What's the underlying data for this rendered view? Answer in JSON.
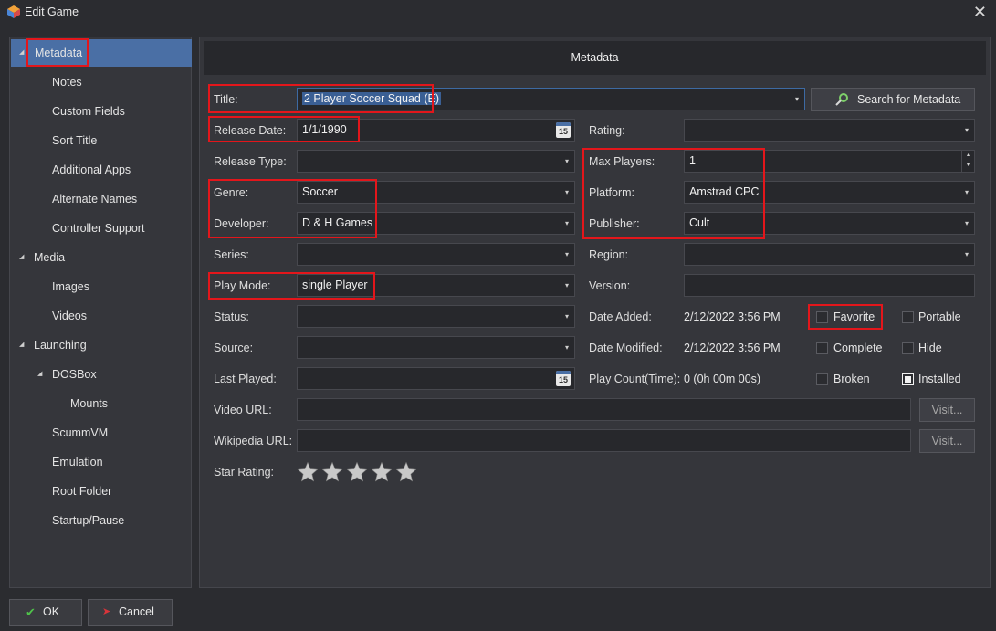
{
  "window": {
    "title": "Edit Game",
    "close_glyph": "✕"
  },
  "sidebar": {
    "items": [
      {
        "label": "Metadata",
        "expander": "◢"
      },
      {
        "label": "Notes"
      },
      {
        "label": "Custom Fields"
      },
      {
        "label": "Sort Title"
      },
      {
        "label": "Additional Apps"
      },
      {
        "label": "Alternate Names"
      },
      {
        "label": "Controller Support"
      },
      {
        "label": "Media",
        "expander": "◢"
      },
      {
        "label": "Images"
      },
      {
        "label": "Videos"
      },
      {
        "label": "Launching",
        "expander": "◢"
      },
      {
        "label": "DOSBox",
        "expander": "◢"
      },
      {
        "label": "Mounts"
      },
      {
        "label": "ScummVM"
      },
      {
        "label": "Emulation"
      },
      {
        "label": "Root Folder"
      },
      {
        "label": "Startup/Pause"
      }
    ]
  },
  "header": {
    "title": "Metadata"
  },
  "fields": {
    "title": {
      "label": "Title:",
      "value": "2 Player Soccer Squad (E)"
    },
    "search_button": "Search for Metadata",
    "release_date": {
      "label": "Release Date:",
      "value": "1/1/1990"
    },
    "rating": {
      "label": "Rating:",
      "value": ""
    },
    "release_type": {
      "label": "Release Type:",
      "value": ""
    },
    "max_players": {
      "label": "Max Players:",
      "value": "1"
    },
    "genre": {
      "label": "Genre:",
      "value": "Soccer"
    },
    "platform": {
      "label": "Platform:",
      "value": "Amstrad CPC"
    },
    "developer": {
      "label": "Developer:",
      "value": "D & H Games"
    },
    "publisher": {
      "label": "Publisher:",
      "value": "Cult"
    },
    "series": {
      "label": "Series:",
      "value": ""
    },
    "region": {
      "label": "Region:",
      "value": ""
    },
    "play_mode": {
      "label": "Play Mode:",
      "value": "single Player"
    },
    "version": {
      "label": "Version:",
      "value": ""
    },
    "status": {
      "label": "Status:",
      "value": ""
    },
    "date_added": {
      "label": "Date Added:",
      "value": "2/12/2022 3:56 PM"
    },
    "source": {
      "label": "Source:",
      "value": ""
    },
    "date_modified": {
      "label": "Date Modified:",
      "value": "2/12/2022 3:56 PM"
    },
    "last_played": {
      "label": "Last Played:",
      "value": ""
    },
    "play_count": {
      "label": "Play Count(Time):",
      "value": "0 (0h 00m 00s)"
    },
    "video_url": {
      "label": "Video URL:",
      "value": ""
    },
    "wikipedia_url": {
      "label": "Wikipedia URL:",
      "value": ""
    },
    "visit_label": "Visit...",
    "star_rating": {
      "label": "Star Rating:",
      "stars": 0,
      "max": 5
    }
  },
  "checkboxes": {
    "favorite": {
      "label": "Favorite",
      "checked": false
    },
    "portable": {
      "label": "Portable",
      "checked": false
    },
    "complete": {
      "label": "Complete",
      "checked": false
    },
    "hide": {
      "label": "Hide",
      "checked": false
    },
    "broken": {
      "label": "Broken",
      "checked": false
    },
    "installed": {
      "label": "Installed",
      "checked": true
    }
  },
  "footer": {
    "ok_label": "OK",
    "cancel_label": "Cancel"
  },
  "icons": {
    "dropdown": "▾",
    "spin_up": "▴",
    "spin_down": "▾",
    "calendar_day": "15",
    "ok_glyph": "✔",
    "cancel_glyph": "➤"
  },
  "colors": {
    "selection": "#4a6fa5",
    "highlight_box": "#e3161b",
    "ok_green": "#4fc24a",
    "cancel_red": "#d8343a"
  }
}
